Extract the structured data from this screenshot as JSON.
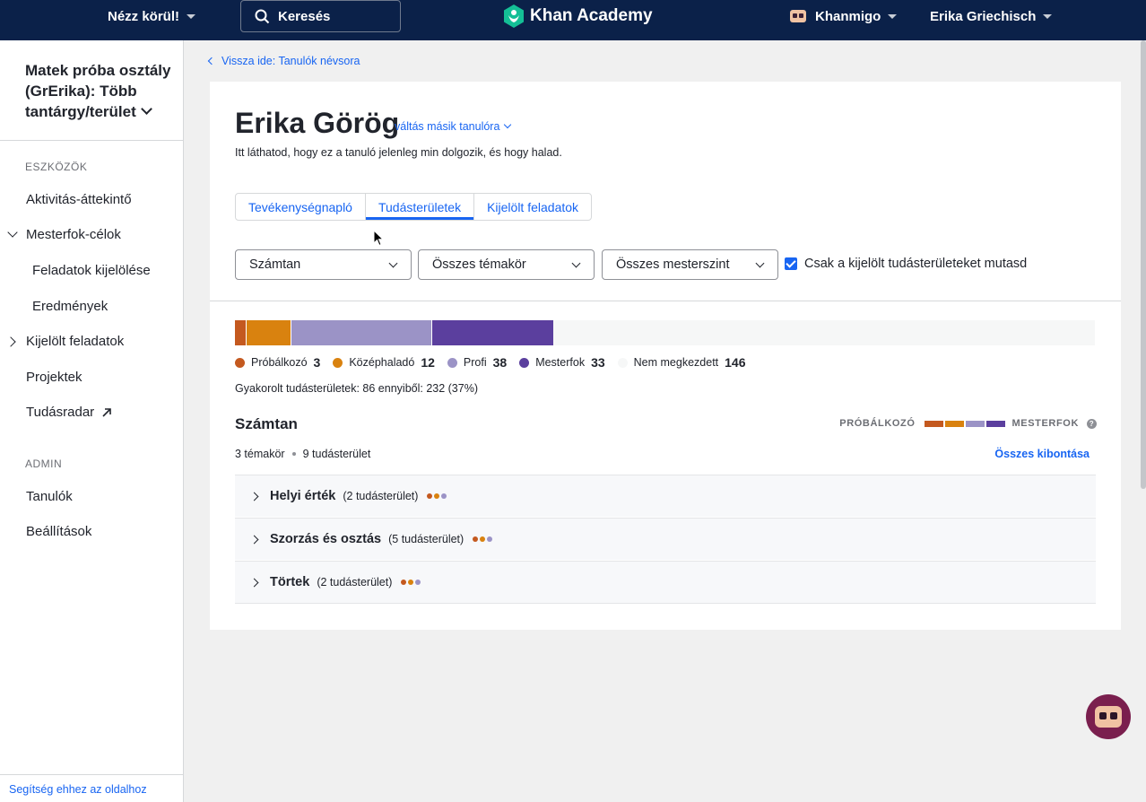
{
  "topbar": {
    "explore": "Nézz körül!",
    "search": "Keresés",
    "brand": "Khan Academy",
    "khanmigo": "Khanmigo",
    "user": "Erika Griechisch"
  },
  "sidebar": {
    "class_title": "Matek próba osztály (GrErika): Több tantárgy/terület",
    "tools_heading": "ESZKÖZÖK",
    "items": [
      {
        "label": "Aktivitás-áttekintő"
      },
      {
        "label": "Mesterfok-célok"
      },
      {
        "label": "Feladatok kijelölése"
      },
      {
        "label": "Eredmények"
      },
      {
        "label": "Kijelölt feladatok"
      },
      {
        "label": "Projektek"
      },
      {
        "label": "Tudásradar"
      }
    ],
    "admin_heading": "ADMIN",
    "admin_items": [
      {
        "label": "Tanulók"
      },
      {
        "label": "Beállítások"
      }
    ],
    "help": "Segítség ehhez az oldalhoz"
  },
  "main": {
    "back_link": "Vissza ide: Tanulók névsora",
    "student_name": "Erika Görög",
    "switch_student": "váltás másik tanulóra",
    "subtitle": "Itt láthatod, hogy ez a tanuló jelenleg min dolgozik, és hogy halad.",
    "tabs": [
      {
        "label": "Tevékenységnapló",
        "active": false
      },
      {
        "label": "Tudásterületek",
        "active": true
      },
      {
        "label": "Kijelölt feladatok",
        "active": false
      }
    ],
    "filters": {
      "subject": "Számtan",
      "unit": "Összes témakör",
      "level": "Összes mesterszint",
      "checkbox_label": "Csak a kijelölt tudásterületeket mutasd",
      "checkbox_checked": true
    },
    "mastery": {
      "levels": [
        {
          "name": "Próbálkozó",
          "count": 3,
          "color": "#c4591f"
        },
        {
          "name": "Középhaladó",
          "count": 12,
          "color": "#d9820f"
        },
        {
          "name": "Profi",
          "count": 38,
          "color": "#9b93c6"
        },
        {
          "name": "Mesterfok",
          "count": 33,
          "color": "#5b3f9e"
        },
        {
          "name": "Nem megkezdett",
          "count": 146,
          "color": "#f6f7f7"
        }
      ],
      "total": 232,
      "practiced_text": "Gyakorolt tudásterületek: 86 ennyiből: 232 (37%)"
    },
    "subject_section": {
      "title": "Számtan",
      "scale_low": "PRÓBÁLKOZÓ",
      "scale_high": "MESTERFOK",
      "units_count": "3 témakör",
      "skills_count": "9 tudásterület",
      "expand_all": "Összes kibontása",
      "units": [
        {
          "name": "Helyi érték",
          "count": "(2 tudásterület)"
        },
        {
          "name": "Szorzás és osztás",
          "count": "(5 tudásterület)"
        },
        {
          "name": "Törtek",
          "count": "(2 tudásterület)"
        }
      ]
    }
  }
}
